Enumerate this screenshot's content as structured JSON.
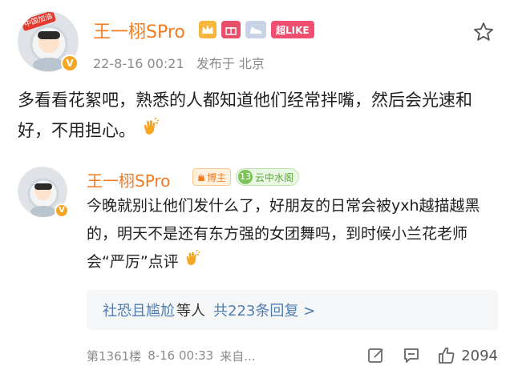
{
  "post": {
    "username": "王一栩SPro",
    "avatar_badge": "中国加油",
    "medals": {
      "like_badge": "超LIKE"
    },
    "time": "22-8-16 00:21",
    "location": "发布于 北京",
    "text": "多看看花絮吧，熟悉的人都知道他们经常拌嘴，然后会光速和好，不用担心。"
  },
  "reply": {
    "username": "王一栩SPro",
    "host_tag": "博主",
    "level_num": "13",
    "level_label": "云中水阁",
    "text": "今晚就别让他们发什么了，好朋友的日常会被yxh越描越黑的，明天不是还有东方强的女团舞吗，到时候小兰花老师会“严厉”点评"
  },
  "more_replies": {
    "users": "社恐且尴尬",
    "suffix": "等人",
    "count_text": "共223条回复 >"
  },
  "footer": {
    "floor": "第1361楼",
    "time": "8-16 00:33",
    "source": "来自...",
    "like_count": "2094"
  },
  "icons": {
    "star": "star-outline-icon",
    "edit": "edit-icon",
    "comment": "comment-icon",
    "like": "thumbs-up-icon",
    "clap": "clapping-hands-icon",
    "verified": "verified-v-icon"
  },
  "colors": {
    "username": "#f07b21",
    "link": "#507daf",
    "meta": "#8a8a8a",
    "like_badge": "#f04f72"
  }
}
